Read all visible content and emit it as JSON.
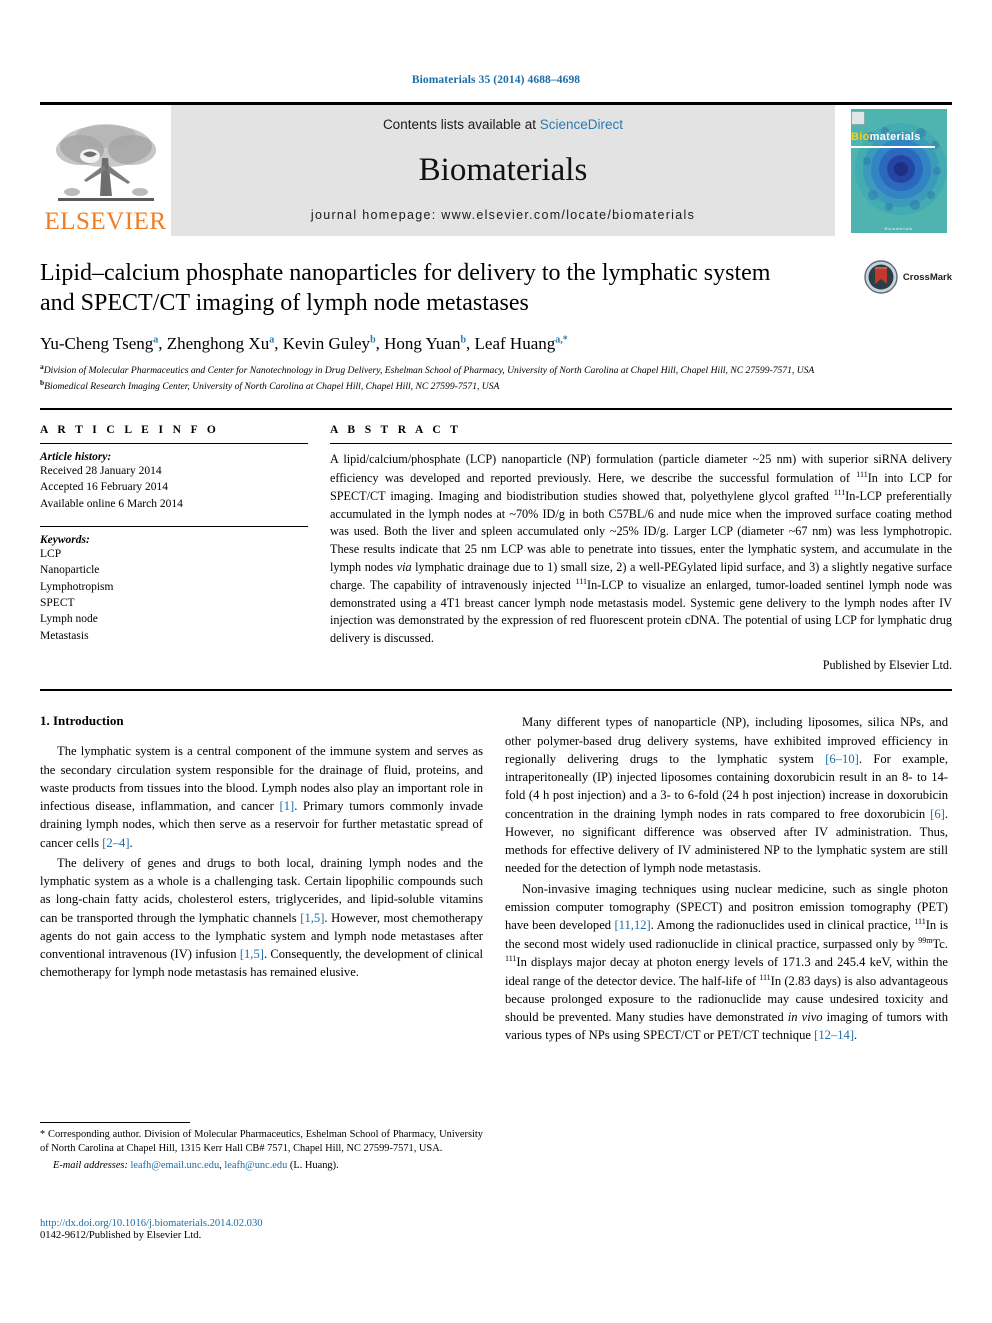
{
  "running_head": "Biomaterials 35 (2014) 4688–4698",
  "banner": {
    "publisher_name": "ELSEVIER",
    "contents_prefix": "Contents lists available at ",
    "contents_link": "ScienceDirect",
    "journal_name": "Biomaterials",
    "homepage": "journal homepage: www.elsevier.com/locate/biomaterials",
    "cover_title_b": "Bio",
    "cover_title_rest": "materials",
    "cover_footer": "Biomaterials"
  },
  "crossmark": {
    "label": "CrossMark"
  },
  "title": "Lipid–calcium phosphate nanoparticles for delivery to the lymphatic system and SPECT/CT imaging of lymph node metastases",
  "authors": [
    {
      "name": "Yu-Cheng Tseng",
      "sup": "a"
    },
    {
      "name": "Zhenghong Xu",
      "sup": "a"
    },
    {
      "name": "Kevin Guley",
      "sup": "b"
    },
    {
      "name": "Hong Yuan",
      "sup": "b"
    },
    {
      "name": "Leaf Huang",
      "sup": "a,*"
    }
  ],
  "affiliations": [
    {
      "marker": "a",
      "text": "Division of Molecular Pharmaceutics and Center for Nanotechnology in Drug Delivery, Eshelman School of Pharmacy, University of North Carolina at Chapel Hill, Chapel Hill, NC 27599-7571, USA"
    },
    {
      "marker": "b",
      "text": "Biomedical Research Imaging Center, University of North Carolina at Chapel Hill, Chapel Hill, NC 27599-7571, USA"
    }
  ],
  "article_info": {
    "heading": "A R T I C L E   I N F O",
    "history_label": "Article history:",
    "history": [
      "Received 28 January 2014",
      "Accepted 16 February 2014",
      "Available online 6 March 2014"
    ],
    "keywords_label": "Keywords:",
    "keywords": [
      "LCP",
      "Nanoparticle",
      "Lymphotropism",
      "SPECT",
      "Lymph node",
      "Metastasis"
    ]
  },
  "abstract": {
    "heading": "A B S T R A C T",
    "published_line": "Published by Elsevier Ltd.",
    "parts": [
      {
        "t": "A lipid/calcium/phosphate (LCP) nanoparticle (NP) formulation (particle diameter ~25 nm) with superior siRNA delivery efficiency was developed and reported previously. Here, we describe the successful formulation of "
      },
      {
        "sup": "111"
      },
      {
        "t": "In into LCP for SPECT/CT imaging. Imaging and biodistribution studies showed that, polyethylene glycol grafted "
      },
      {
        "sup": "111"
      },
      {
        "t": "In-LCP preferentially accumulated in the lymph nodes at ~70% ID/g in both C57BL/6 and nude mice when the improved surface coating method was used. Both the liver and spleen accumulated only ~25% ID/g. Larger LCP (diameter ~67 nm) was less lymphotropic. These results indicate that 25 nm LCP was able to penetrate into tissues, enter the lymphatic system, and accumulate in the lymph nodes "
      },
      {
        "i": "via"
      },
      {
        "t": " lymphatic drainage due to 1) small size, 2) a well-PEGylated lipid surface, and 3) a slightly negative surface charge. The capability of intravenously injected "
      },
      {
        "sup": "111"
      },
      {
        "t": "In-LCP to visualize an enlarged, tumor-loaded sentinel lymph node was demonstrated using a 4T1 breast cancer lymph node metastasis model. Systemic gene delivery to the lymph nodes after IV injection was demonstrated by the expression of red fluorescent protein cDNA. The potential of using LCP for lymphatic drug delivery is discussed."
      }
    ]
  },
  "intro": {
    "section_title": "1.  Introduction",
    "left_paragraphs": [
      [
        {
          "t": "The lymphatic system is a central component of the immune system and serves as the secondary circulation system responsible for the drainage of fluid, proteins, and waste products from tissues into the blood. Lymph nodes also play an important role in infectious disease, inflammation, and cancer "
        },
        {
          "ref": "[1]"
        },
        {
          "t": ". Primary tumors commonly invade draining lymph nodes, which then serve as a reservoir for further metastatic spread of cancer cells "
        },
        {
          "ref": "[2–4]"
        },
        {
          "t": "."
        }
      ],
      [
        {
          "t": "The delivery of genes and drugs to both local, draining lymph nodes and the lymphatic system as a whole is a challenging task. Certain lipophilic compounds such as long-chain fatty acids, cholesterol esters, triglycerides, and lipid-soluble vitamins can be transported through the lymphatic channels "
        },
        {
          "ref": "[1,5]"
        },
        {
          "t": ". However, most chemotherapy agents do not gain access to the lymphatic system and lymph node metastases after conventional intravenous (IV) infusion "
        },
        {
          "ref": "[1,5]"
        },
        {
          "t": ". Consequently, the development of clinical chemotherapy for lymph node metastasis has remained elusive."
        }
      ]
    ],
    "right_paragraphs": [
      [
        {
          "t": "Many different types of nanoparticle (NP), including liposomes, silica NPs, and other polymer-based drug delivery systems, have exhibited improved efficiency in regionally delivering drugs to the lymphatic system "
        },
        {
          "ref": "[6–10]"
        },
        {
          "t": ". For example, intraperitoneally (IP) injected liposomes containing doxorubicin result in an 8- to 14-fold (4 h post injection) and a 3- to 6-fold (24 h post injection) increase in doxorubicin concentration in the draining lymph nodes in rats compared to free doxorubicin "
        },
        {
          "ref": "[6]"
        },
        {
          "t": ". However, no significant difference was observed after IV administration. Thus, methods for effective delivery of IV administered NP to the lymphatic system are still needed for the detection of lymph node metastasis."
        }
      ],
      [
        {
          "t": "Non-invasive imaging techniques using nuclear medicine, such as single photon emission computer tomography (SPECT) and positron emission tomography (PET) have been developed "
        },
        {
          "ref": "[11,12]"
        },
        {
          "t": ". Among the radionuclides used in clinical practice, "
        },
        {
          "sup": "111"
        },
        {
          "t": "In is the second most widely used radionuclide in clinical practice, surpassed only by "
        },
        {
          "sup": "99m"
        },
        {
          "t": "Tc. "
        },
        {
          "sup": "111"
        },
        {
          "t": "In displays major decay at photon energy levels of 171.3 and 245.4 keV, within the ideal range of the detector device. The half-life of "
        },
        {
          "sup": "111"
        },
        {
          "t": "In (2.83 days) is also advantageous because prolonged exposure to the radionuclide may cause undesired toxicity and should be prevented. Many studies have demonstrated "
        },
        {
          "i": "in vivo"
        },
        {
          "t": " imaging of tumors with various types of NPs using SPECT/CT or PET/CT technique "
        },
        {
          "ref": "[12–14]"
        },
        {
          "t": "."
        }
      ]
    ]
  },
  "footnote": {
    "corresponding": "* Corresponding author. Division of Molecular Pharmaceutics, Eshelman School of Pharmacy, University of North Carolina at Chapel Hill, 1315 Kerr Hall CB# 7571, Chapel Hill, NC 27599-7571, USA.",
    "email_label": "E-mail addresses:",
    "email1": "leafh@email.unc.edu",
    "email_sep": ", ",
    "email2": "leafh@unc.edu",
    "email_suffix": " (L. Huang)."
  },
  "footer": {
    "doi": "http://dx.doi.org/10.1016/j.biomaterials.2014.02.030",
    "issn": "0142-9612/Published by Elsevier Ltd."
  },
  "colors": {
    "link": "#1b6ca8",
    "elsevier_orange": "#f07c23",
    "banner_gray": "#e3e3e3",
    "cover_teal": "#4fb3b0"
  }
}
